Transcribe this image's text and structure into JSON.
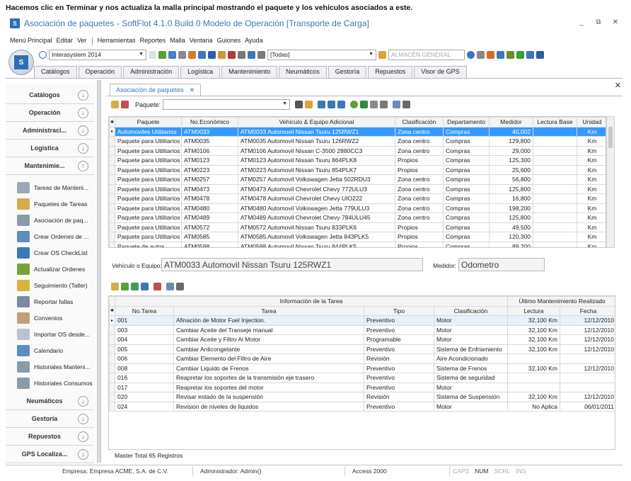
{
  "caption": "Hacemos clic en Terminar y nos actualiza la malla principal mostrando el paquete y los vehículos asociados a este.",
  "window": {
    "title": "Asociación de paquetes - SoftFlot 4.1.0 Build 0  Modelo de Operación [Transporte de Carga]",
    "controls": [
      "_",
      "⧉",
      "✕"
    ]
  },
  "menu": [
    "Menú Principal",
    "Editar",
    "Ver",
    "Herramientas",
    "Reportes",
    "Malla",
    "Ventana",
    "Guiones",
    "Ayuda"
  ],
  "toolbar": {
    "system_value": "Interasystem 2014",
    "todas_value": "[Todas]",
    "almacen_placeholder": "ALMACÉN GENERAL"
  },
  "tabs": [
    "Catálogos",
    "Operación",
    "Administración",
    "Logística",
    "Mantenimiento",
    "Neumáticos",
    "Gestoría",
    "Repuestos",
    "Visor de GPS"
  ],
  "sidebar": {
    "headers_top": [
      "Catálogos",
      "Operación",
      "Administraci...",
      "Logística",
      "Mantenimie..."
    ],
    "items": [
      "Tareas de Manteni...",
      "Paquetes de Tareas",
      "Asociación de paq...",
      "Crear Ordenes de ...",
      "Crear OS CheckList",
      "Actualizar Ordenes",
      "Seguimiento (Taller)",
      "Reportar fallas",
      "Convenios",
      "Importar OS desde...",
      "Calendario",
      "Historiales Manteni...",
      "Historiales Consumos"
    ],
    "headers_bottom": [
      "Neumáticos",
      "Gestoría",
      "Repuestos",
      "GPS Localiza..."
    ]
  },
  "document_tab": {
    "label": "Asociación de paquetes",
    "close": "✕"
  },
  "doc_close": "✕",
  "paquete_label": "Paquete:",
  "grid_packages": {
    "columns": [
      "Paquete",
      "No.Económico",
      "Vehículo & Equipo Adicional",
      "Clasificación",
      "Departamento",
      "Medidor",
      "Lectura Base",
      "Unidad"
    ],
    "rows": [
      [
        "Automoviles Utilitarios",
        "ATM0033",
        "ATM0033 Automovil  Nissan  Tsuru  125RWZ1",
        "Zona centro",
        "Compras",
        "40,002",
        "",
        "Km"
      ],
      [
        "Paquete para Utilitarios",
        "ATM0035",
        "ATM0035 Automovil  Nissan  Tsuru  126RWZ2",
        "Zona centro",
        "Compras",
        "129,800",
        "",
        "Km"
      ],
      [
        "Paquete para Utilitarios",
        "ATM0106",
        "ATM0106 Automovil  Nissan  C-3500  2880CC3",
        "Zona centro",
        "Compras",
        "29,000",
        "",
        "Km"
      ],
      [
        "Paquete para Utilitarios",
        "ATM0123",
        "ATM0123 Automovil  Nissan  Tsuru  864PLK8",
        "Propios",
        "Compras",
        "125,300",
        "",
        "Km"
      ],
      [
        "Paquete para Utilitarios",
        "ATM0223",
        "ATM0223 Automovil  Nissan  Tsuru  854PLK7",
        "Propios",
        "Compras",
        "25,600",
        "",
        "Km"
      ],
      [
        "Paquete para Utilitarios",
        "ATM0257",
        "ATM0257 Automovil  Volkswagen  Jetta  502RDU3",
        "Zona centro",
        "Compras",
        "56,800",
        "",
        "Km"
      ],
      [
        "Paquete para Utilitarios",
        "ATM0473",
        "ATM0473 Automovil  Chevrolet  Chevy  772ULU3",
        "Zona centro",
        "Compras",
        "125,800",
        "",
        "Km"
      ],
      [
        "Paquete para Utilitarios",
        "ATM0478",
        "ATM0478 Automovil  Chevrolet  Chevy  UIO222",
        "Zona centro",
        "Compras",
        "16,800",
        "",
        "Km"
      ],
      [
        "Paquete para Utilitarios",
        "ATM0480",
        "ATM0480 Automovil  Volkswagen  Jetta  779ULU3",
        "Zona centro",
        "Compras",
        "198,200",
        "",
        "Km"
      ],
      [
        "Paquete para Utilitarios",
        "ATM0489",
        "ATM0489 Automovil  Chevrolet  Chevy  784ULU45",
        "Zona centro",
        "Compras",
        "125,800",
        "",
        "Km"
      ],
      [
        "Paquete para Utilitarios",
        "ATM0572",
        "ATM0572 Automovil  Nissan  Tsuru  833PLK6",
        "Propios",
        "Compras",
        "49,500",
        "",
        "Km"
      ],
      [
        "Paquete para Utilitarios",
        "ATM0585",
        "ATM0585 Automovil  Volkswagen  Jetta  843PLK5",
        "Propios",
        "Compras",
        "120,300",
        "",
        "Km"
      ],
      [
        "Paquete de autos",
        "ATM0588",
        "ATM0588 Automovil  Nissan  Tsuru  844PLK5",
        "Propios",
        "Compras",
        "89,200",
        "",
        "Km"
      ]
    ]
  },
  "vehicle": {
    "label": "Vehículo o Equipo:",
    "value": "ATM0033 Automovil  Nissan  Tsuru  125RWZ1"
  },
  "medidor": {
    "label": "Medidor:",
    "value": "Odometro"
  },
  "grid_tasks": {
    "group_info": "Información de la Tarea",
    "group_last": "Último Mantenimiento Realizado",
    "columns": [
      "No.Tarea",
      "Tarea",
      "Tipo",
      "Clasificación",
      "Lectura",
      "Fecha"
    ],
    "rows": [
      [
        "001",
        "Afinación de Motor Fuel Injection.",
        "Preventivo",
        "Motor",
        "32,100 Km",
        "12/12/2010"
      ],
      [
        "003",
        "Cambiar Aceite del Transeje manual",
        "Preventivo",
        "Motor",
        "32,100 Km",
        "12/12/2010"
      ],
      [
        "004",
        "Cambiar Aceite y Filtro Al Motor",
        "Programable",
        "Motor",
        "32,100 Km",
        "12/12/2010"
      ],
      [
        "005",
        "Cambiar Anticongelante",
        "Preventivo",
        "Sistema de Enfriamiento",
        "32,100 Km",
        "12/12/2010"
      ],
      [
        "006",
        "Cambiar Elemento del Filtro de Aire",
        "Revisión",
        "Aire Acondicionado",
        "",
        ""
      ],
      [
        "008",
        "Cambiar Liquido de Frenos",
        "Preventivo",
        "Sistema de Frenos",
        "32,100 Km",
        "12/12/2010"
      ],
      [
        "016",
        "Reapretar los soportes de la transmisión eje trasero",
        "Preventivo",
        "Sistema de seguridad",
        "",
        ""
      ],
      [
        "017",
        "Reapretar los soportes del motor",
        "Preventivo",
        "Motor",
        "",
        ""
      ],
      [
        "020",
        "Revisar estado de la suspensión",
        "Revisión",
        "Sistema de Suspensión",
        "32,100 Km",
        "12/12/2010"
      ],
      [
        "024",
        "Revision de niveles de liquidos",
        "Preventivo",
        "Motor",
        "No Aplica",
        "06/01/2011"
      ]
    ]
  },
  "footer": "Master Total 65 Registros",
  "status": {
    "empresa": "Empresa: Empresa ACME, S.A. de C.V.",
    "admin": "Administrador: Admin()",
    "access": "Access 2000",
    "keys": [
      "CAPS",
      "NUM",
      "SCRL",
      "INS"
    ]
  }
}
